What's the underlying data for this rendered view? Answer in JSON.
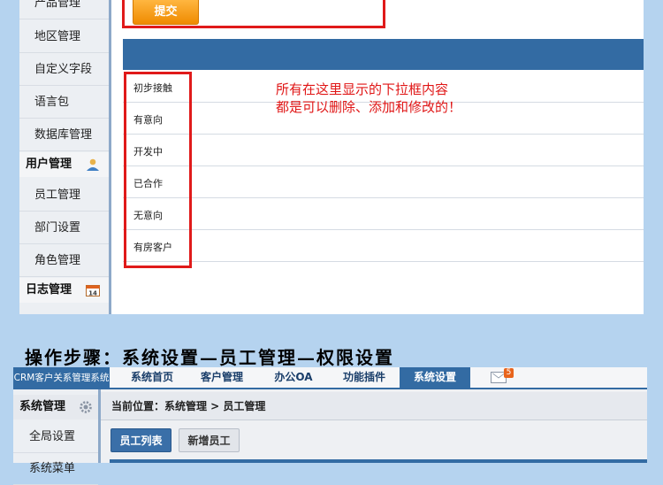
{
  "upper": {
    "sidebar": {
      "items_top": [
        "产品管理",
        "地区管理",
        "自定义字段",
        "语言包",
        "数据库管理"
      ],
      "section_user": "用户管理",
      "items_user": [
        "员工管理",
        "部门设置",
        "角色管理"
      ],
      "section_log": "日志管理",
      "calendar_icon_text": "14"
    },
    "submit_label": "提交",
    "options": [
      "初步接触",
      "有意向",
      "开发中",
      "已合作",
      "无意向",
      "有房客户"
    ],
    "note_line1": "所有在这里显示的下拉框内容",
    "note_line2": "都是可以删除、添加和修改的！",
    "accent_red": "#e01a1a",
    "header_blue": "#336ba3"
  },
  "heading": "操作步骤：系统设置—员工管理—权限设置",
  "lower": {
    "app_title": "CRM客户关系管理系统",
    "nav": [
      "系统首页",
      "客户管理",
      "办公OA",
      "功能插件",
      "系统设置"
    ],
    "active_nav": "系统设置",
    "mail_badge": "5",
    "sidebar_section": "系统管理",
    "sidebar_items": [
      "全局设置",
      "系统菜单"
    ],
    "breadcrumb": "当前位置：系统管理 > 员工管理",
    "buttons": [
      "员工列表",
      "新增员工"
    ]
  }
}
